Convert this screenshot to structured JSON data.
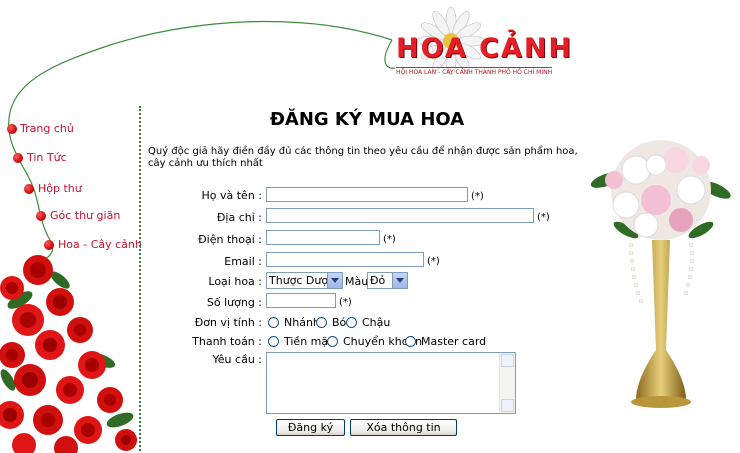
{
  "logo": {
    "title": "HOA CẢNH",
    "subtitle": "HỘI HOA LAN - CÂY CẢNH THÀNH PHỐ HỒ CHÍ MINH"
  },
  "nav": {
    "items": [
      {
        "label": "Trang chủ"
      },
      {
        "label": "Tin Tức"
      },
      {
        "label": "Hộp thư"
      },
      {
        "label": "Góc thư giãn"
      },
      {
        "label": "Hoa - Cây cảnh"
      }
    ]
  },
  "page": {
    "title": "ĐĂNG KÝ MUA HOA",
    "intro": "Quý độc giả hãy điền đầy đủ các thông tin theo yêu cầu để nhận được sản phẩm hoa, cây cảnh ưu thích nhất"
  },
  "form": {
    "required_mark": "(*)",
    "fullname": {
      "label": "Họ và tên :",
      "value": ""
    },
    "address": {
      "label": "Địa chỉ :",
      "value": ""
    },
    "phone": {
      "label": "Điện thoại :",
      "value": ""
    },
    "email": {
      "label": "Email :",
      "value": ""
    },
    "flower_type": {
      "label": "Loại hoa :",
      "selected": "Thược Dược"
    },
    "color": {
      "label": "Màu",
      "selected": "Đỏ"
    },
    "quantity": {
      "label": "Số lượng :",
      "value": ""
    },
    "unit": {
      "label": "Đơn vị tính :",
      "options": [
        "Nhánh",
        "Bó",
        "Chậu"
      ]
    },
    "payment": {
      "label": "Thanh toán :",
      "options": [
        "Tiền mặt",
        "Chuyển khoản",
        "Master card"
      ]
    },
    "notes": {
      "label": "Yêu cầu :",
      "value": ""
    },
    "submit_label": "Đăng ký",
    "reset_label": "Xóa thông tin"
  }
}
